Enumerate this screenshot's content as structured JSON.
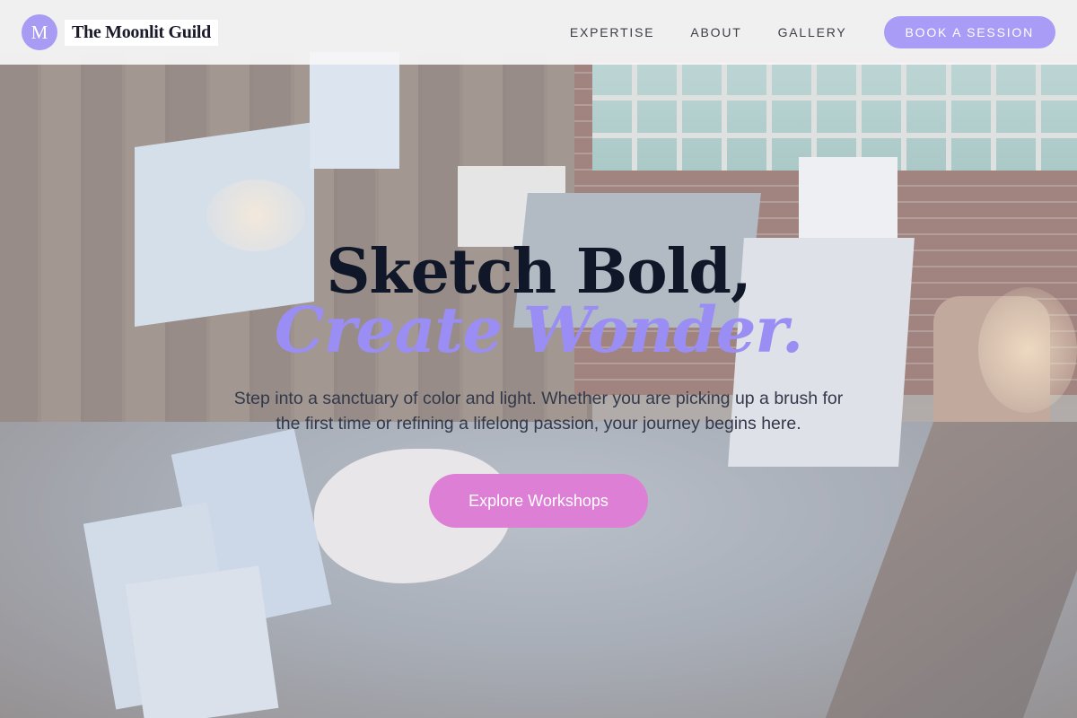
{
  "header": {
    "logo_letter": "M",
    "brand_name": "The Moonlit Guild",
    "nav": [
      {
        "label": "EXPERTISE"
      },
      {
        "label": "ABOUT"
      },
      {
        "label": "GALLERY"
      }
    ],
    "cta_label": "BOOK A SESSION"
  },
  "hero": {
    "headline_line1": "Sketch Bold,",
    "headline_line2": "Create Wonder.",
    "subtext": "Step into a sanctuary of color and light. Whether you are picking up a brush for the first time or refining a lifelong passion, your journey begins here.",
    "cta_label": "Explore Workshops"
  },
  "colors": {
    "accent_lavender": "#a99cf7",
    "accent_pink": "#de7fd6",
    "headline_dark": "#0f1728"
  }
}
